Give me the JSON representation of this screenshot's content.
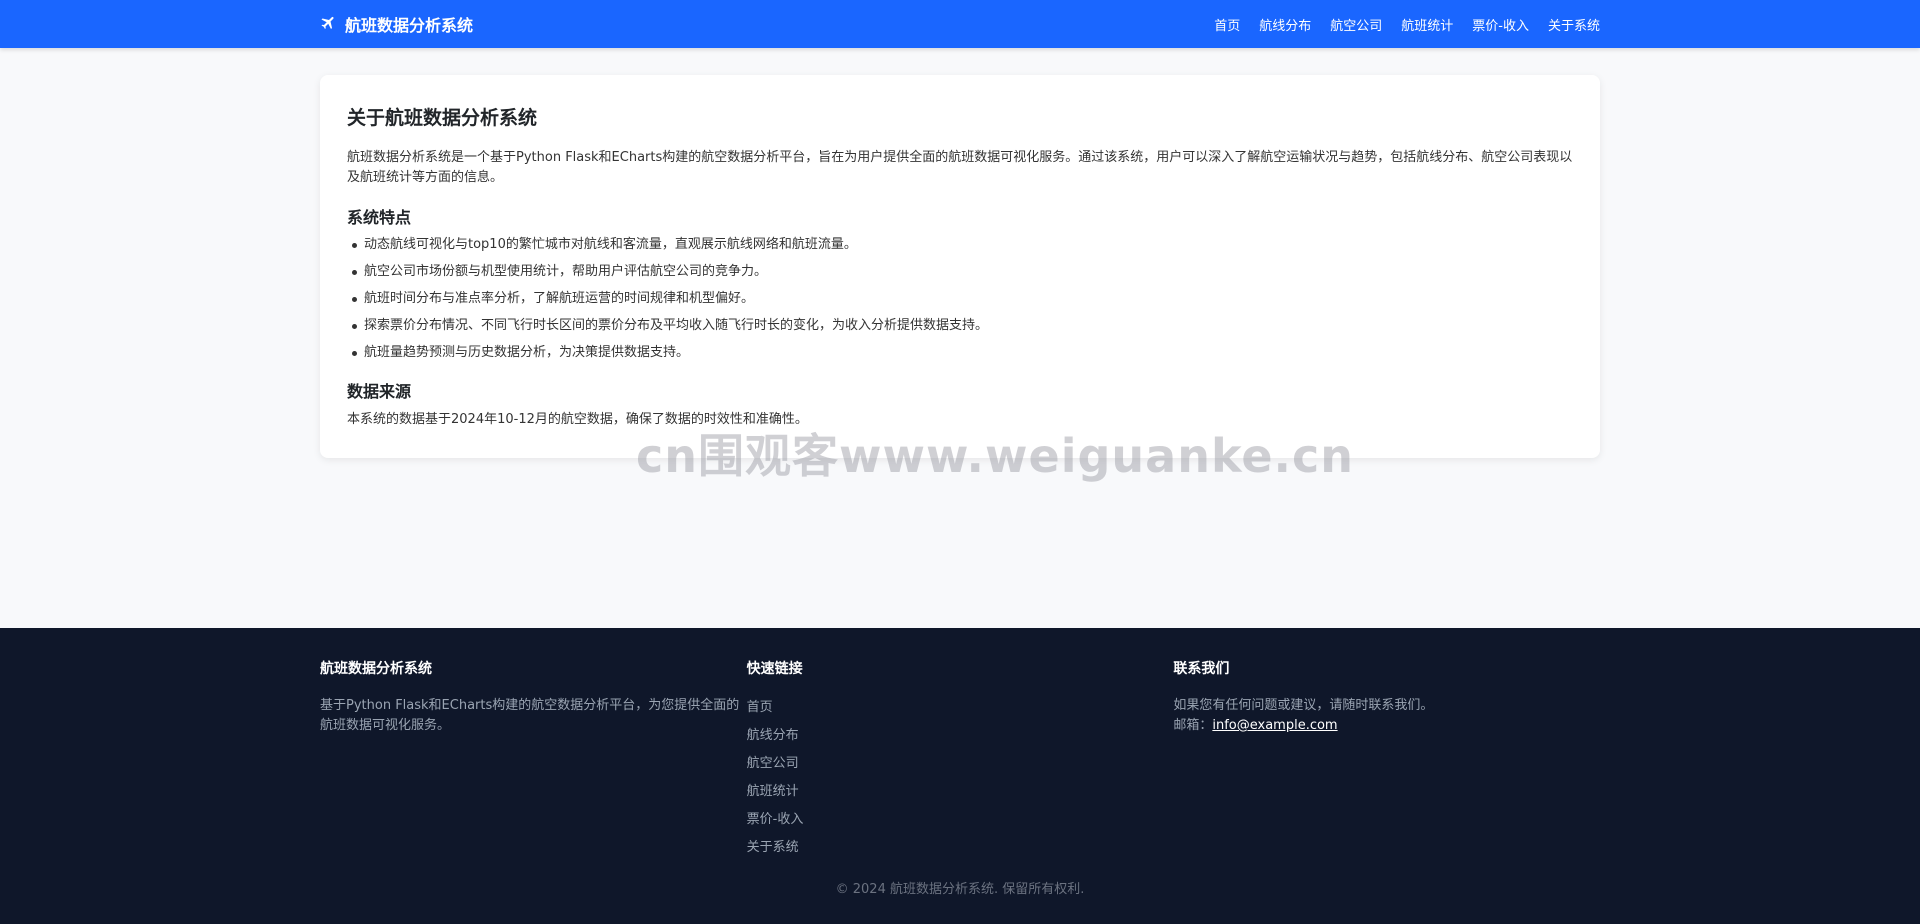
{
  "nav": {
    "brand": "航班数据分析系统",
    "brand_icon": "plane-icon",
    "links": [
      "首页",
      "航线分布",
      "航空公司",
      "航班统计",
      "票价-收入",
      "关于系统"
    ]
  },
  "about": {
    "title": "关于航班数据分析系统",
    "intro": "航班数据分析系统是一个基于Python Flask和ECharts构建的航空数据分析平台，旨在为用户提供全面的航班数据可视化服务。通过该系统，用户可以深入了解航空运输状况与趋势，包括航线分布、航空公司表现以及航班统计等方面的信息。",
    "features_title": "系统特点",
    "features": [
      "动态航线可视化与top10的繁忙城市对航线和客流量，直观展示航线网络和航班流量。",
      "航空公司市场份额与机型使用统计，帮助用户评估航空公司的竞争力。",
      "航班时间分布与准点率分析，了解航班运营的时间规律和机型偏好。",
      "探索票价分布情况、不同飞行时长区间的票价分布及平均收入随飞行时长的变化，为收入分析提供数据支持。",
      "航班量趋势预测与历史数据分析，为决策提供数据支持。"
    ],
    "source_title": "数据来源",
    "source_text": "本系统的数据基于2024年10-12月的航空数据，确保了数据的时效性和准确性。"
  },
  "watermark": "cn围观客www.weiguanke.cn",
  "footer": {
    "col1": {
      "title": "航班数据分析系统",
      "text": "基于Python Flask和ECharts构建的航空数据分析平台，为您提供全面的航班数据可视化服务。"
    },
    "col2": {
      "title": "快速链接",
      "links": [
        "首页",
        "航线分布",
        "航空公司",
        "航班统计",
        "票价-收入",
        "关于系统"
      ]
    },
    "col3": {
      "title": "联系我们",
      "text": "如果您有任何问题或建议，请随时联系我们。",
      "email_label": "邮箱：",
      "email": "info@example.com"
    },
    "copyright": "© 2024 航班数据分析系统. 保留所有权利."
  },
  "colors": {
    "navbar": "#1a66ff",
    "footer": "#0f172a",
    "page_bg": "#f8f9fb"
  }
}
